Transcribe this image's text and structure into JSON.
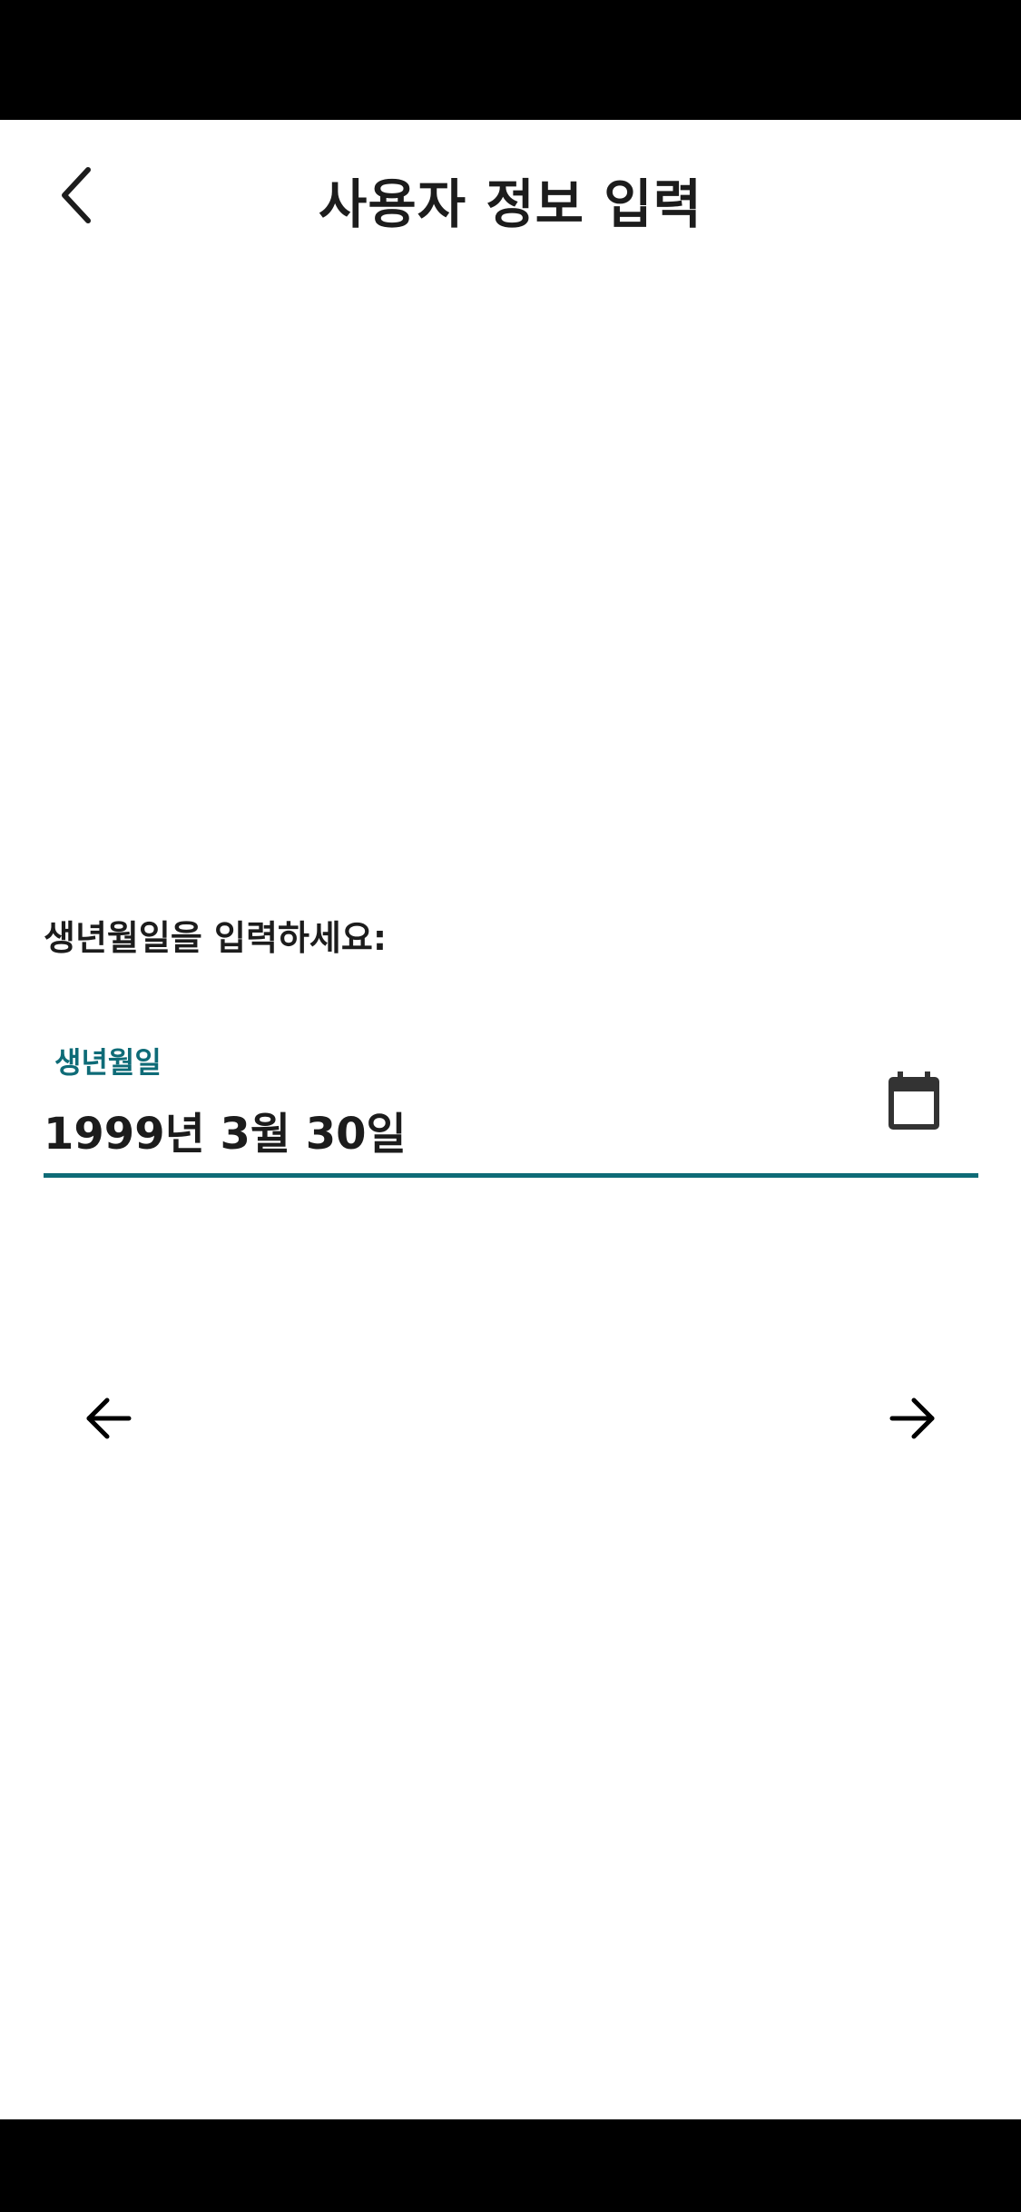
{
  "header": {
    "title": "사용자 정보 입력",
    "back_icon": "chevron-left-icon"
  },
  "form": {
    "prompt": "생년월일을 입력하세요:",
    "birthdate_field": {
      "label": "생년월일",
      "value": "1999년 3월 30일",
      "icon": "calendar-icon"
    }
  },
  "navigation": {
    "prev_icon": "arrow-left-icon",
    "next_icon": "arrow-right-icon"
  },
  "colors": {
    "accent": "#0e6b77",
    "text": "#1c1c1c",
    "system_bars": "#000000"
  }
}
